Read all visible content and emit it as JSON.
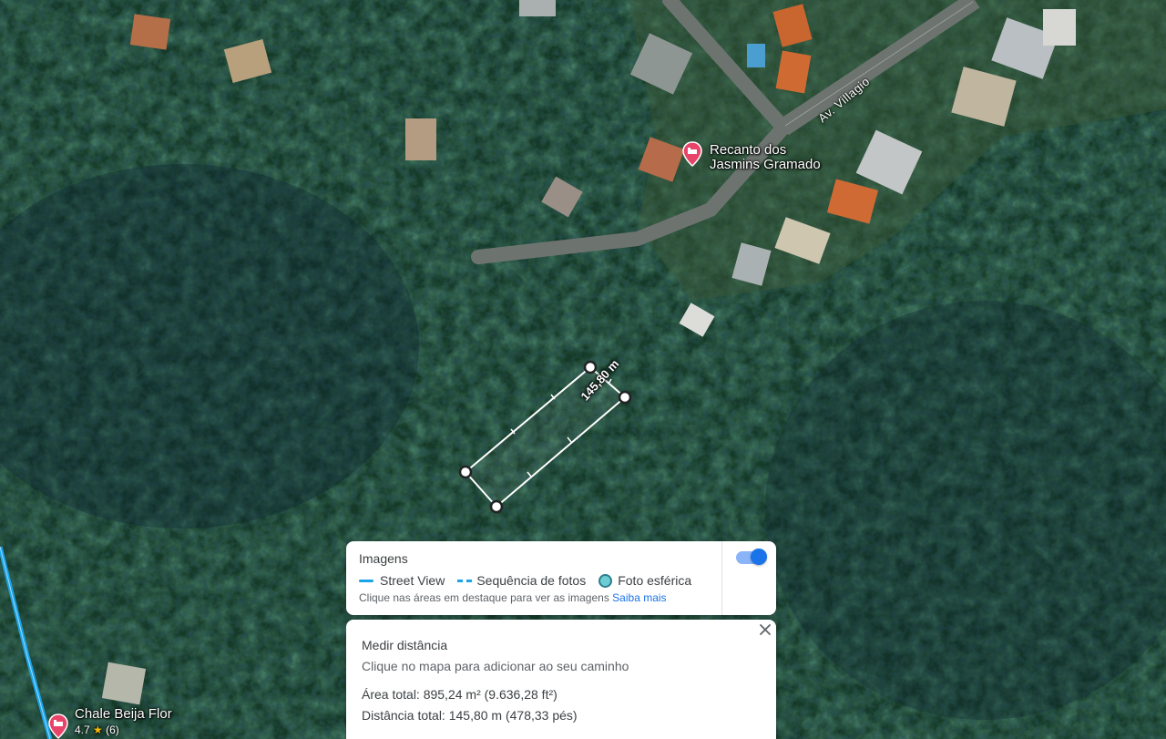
{
  "map": {
    "street_name": "Av. Villagio",
    "measure_segment_label": "145,80 m",
    "pois": [
      {
        "name": "Recanto dos Jasmins Gramado",
        "line1": "Recanto dos",
        "line2": "Jasmins Gramado",
        "icon": "hotel-pin-icon"
      },
      {
        "name": "Chale Beija Flor",
        "rating": "4.7",
        "reviews": "(6)",
        "icon": "hotel-pin-icon"
      }
    ]
  },
  "imagens_panel": {
    "title": "Imagens",
    "legend": {
      "street_view": "Street View",
      "photo_sequence": "Sequência de fotos",
      "spherical_photo": "Foto esférica"
    },
    "hint": "Clique nas áreas em destaque para ver as imagens",
    "learn_more": "Saiba mais",
    "toggle_on": true
  },
  "measure_panel": {
    "title": "Medir distância",
    "hint": "Clique no mapa para adicionar ao seu caminho",
    "total_area": "Área total: 895,24 m² (9.636,28 ft²)",
    "total_distance": "Distância total: 145,80 m (478,33 pés)"
  },
  "colors": {
    "forest_dark": "#0f2a1c",
    "street_view_line": "#1aa3e8",
    "accent_blue": "#1a73e8",
    "poi_pin": "#e8446a"
  }
}
